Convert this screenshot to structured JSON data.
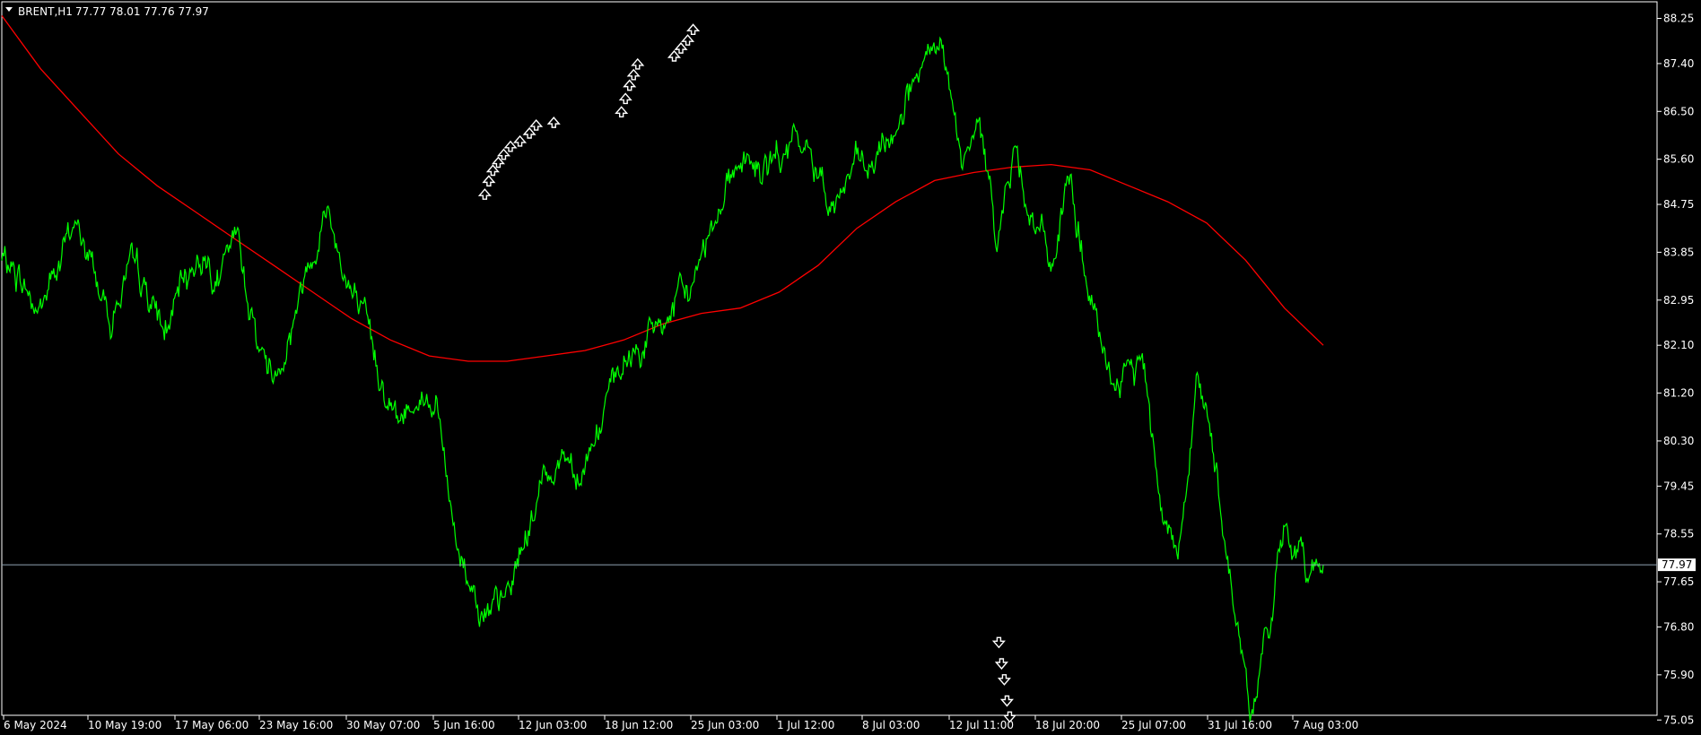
{
  "header": {
    "symbol": "BRENT,H1",
    "ohlc": "77.77 78.01 77.76 77.97"
  },
  "colors": {
    "background": "#000000",
    "frame": "#ffffff",
    "price_line": "#00ff00",
    "moving_average": "#ff0000",
    "bid_line": "#8fa3b3",
    "arrows": "#ffffff",
    "price_tag_bg": "#ffffff",
    "price_tag_text": "#000000"
  },
  "chart_data": {
    "type": "line",
    "symbol": "BRENT",
    "timeframe": "H1",
    "y_ticks": [
      "88.25",
      "87.40",
      "86.50",
      "85.60",
      "84.75",
      "83.85",
      "82.95",
      "82.10",
      "81.20",
      "80.30",
      "79.45",
      "78.55",
      "77.65",
      "76.80",
      "75.90",
      "75.05"
    ],
    "x_ticks": [
      "6 May 2024",
      "10 May 19:00",
      "17 May 06:00",
      "23 May 16:00",
      "30 May 07:00",
      "5 Jun 16:00",
      "12 Jun 03:00",
      "18 Jun 12:00",
      "25 Jun 03:00",
      "1 Jul 12:00",
      "8 Jul 03:00",
      "12 Jul 11:00",
      "18 Jul 20:00",
      "25 Jul 07:00",
      "31 Jul 16:00",
      "7 Aug 03:00"
    ],
    "ylim": [
      74.7,
      88.6
    ],
    "current_price": "77.97",
    "x_points": 68,
    "series": [
      {
        "values": [
          83.7,
          83.4,
          82.7,
          83.5,
          84.4,
          83.6,
          82.6,
          83.5,
          83.1,
          82.3,
          83.2,
          83.9,
          83.3,
          84.1,
          82.4,
          81.5,
          82.5,
          83.8,
          84.7,
          83.4,
          82.4,
          81.5,
          80.6,
          81.3,
          81.0,
          78.6,
          77.6,
          76.9,
          77.4,
          78.6,
          79.6,
          80.1,
          79.8,
          80.6,
          81.4,
          82.0,
          82.3,
          82.7,
          83.1,
          84.2,
          85.2,
          85.7,
          85.3,
          85.6,
          85.9,
          85.4,
          84.8,
          85.4,
          85.3,
          85.9,
          86.8,
          87.2,
          87.7,
          85.4,
          86.1,
          84.3,
          85.7,
          84.5,
          83.6,
          85.2,
          83.2,
          81.5,
          81.4,
          81.9,
          79.4,
          78.1,
          81.6,
          79.9,
          77.5,
          75.1,
          76.9,
          78.6,
          78.0,
          77.97
        ]
      },
      {
        "values": [
          88.3,
          87.3,
          86.5,
          85.7,
          85.1,
          84.6,
          84.1,
          83.6,
          83.1,
          82.6,
          82.2,
          81.9,
          81.8,
          81.8,
          81.9,
          82.0,
          82.2,
          82.5,
          82.7,
          82.8,
          83.1,
          83.6,
          84.3,
          84.8,
          85.2,
          85.35,
          85.45,
          85.5,
          85.4,
          85.1,
          84.8,
          84.4,
          83.7,
          82.8,
          82.1
        ]
      }
    ],
    "signal_arrows": [
      {
        "x": 0.357,
        "y": 84.95,
        "dir": "up"
      },
      {
        "x": 0.36,
        "y": 85.2,
        "dir": "up"
      },
      {
        "x": 0.363,
        "y": 85.4,
        "dir": "up"
      },
      {
        "x": 0.367,
        "y": 85.55,
        "dir": "up"
      },
      {
        "x": 0.371,
        "y": 85.7,
        "dir": "up"
      },
      {
        "x": 0.376,
        "y": 85.85,
        "dir": "up"
      },
      {
        "x": 0.383,
        "y": 85.95,
        "dir": "up"
      },
      {
        "x": 0.39,
        "y": 86.1,
        "dir": "up"
      },
      {
        "x": 0.395,
        "y": 86.25,
        "dir": "up"
      },
      {
        "x": 0.408,
        "y": 86.3,
        "dir": "up"
      },
      {
        "x": 0.458,
        "y": 86.5,
        "dir": "up"
      },
      {
        "x": 0.461,
        "y": 86.75,
        "dir": "up"
      },
      {
        "x": 0.464,
        "y": 87.0,
        "dir": "up"
      },
      {
        "x": 0.467,
        "y": 87.2,
        "dir": "up"
      },
      {
        "x": 0.47,
        "y": 87.4,
        "dir": "up"
      },
      {
        "x": 0.497,
        "y": 87.55,
        "dir": "up"
      },
      {
        "x": 0.502,
        "y": 87.7,
        "dir": "up"
      },
      {
        "x": 0.507,
        "y": 87.85,
        "dir": "up"
      },
      {
        "x": 0.511,
        "y": 88.05,
        "dir": "up"
      },
      {
        "x": 0.737,
        "y": 76.5,
        "dir": "down"
      },
      {
        "x": 0.739,
        "y": 76.1,
        "dir": "down"
      },
      {
        "x": 0.741,
        "y": 75.8,
        "dir": "down"
      },
      {
        "x": 0.743,
        "y": 75.4,
        "dir": "down"
      },
      {
        "x": 0.745,
        "y": 75.1,
        "dir": "down"
      }
    ]
  }
}
